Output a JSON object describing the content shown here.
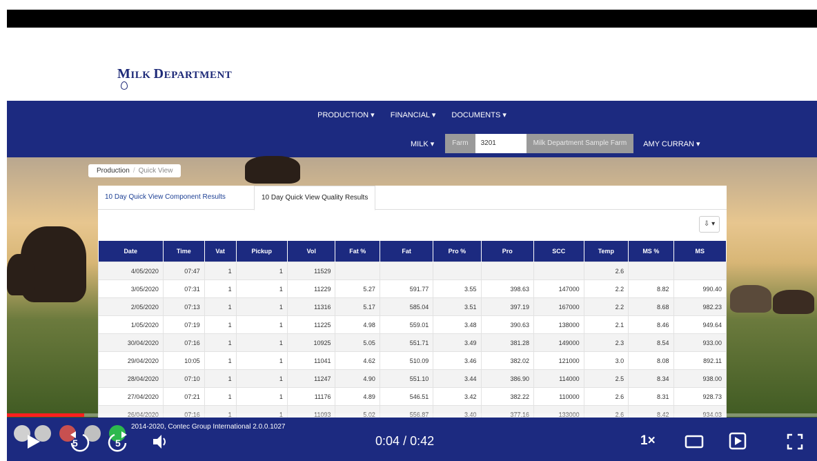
{
  "brand": {
    "title_big": "M",
    "title_rest": "ILK ",
    "title_big2": "D",
    "title_rest2": "EPARTMENT"
  },
  "nav": {
    "production": "PRODUCTION ▾",
    "financial": "FINANCIAL ▾",
    "documents": "DOCUMENTS ▾",
    "milk": "MILK ▾",
    "farm_label": "Farm",
    "farm_value": "3201",
    "farm_name": "Milk Department Sample Farm",
    "user": "AMY CURRAN ▾"
  },
  "breadcrumb": {
    "parent": "Production",
    "separator": "/",
    "current": "Quick View"
  },
  "tabs": [
    "10 Day Quick View Component Results",
    "10 Day Quick View Quality Results"
  ],
  "export_label": "⇩ ▾",
  "table": {
    "headers": [
      "Date",
      "Time",
      "Vat",
      "Pickup",
      "Vol",
      "Fat %",
      "Fat",
      "Pro %",
      "Pro",
      "SCC",
      "Temp",
      "MS %",
      "MS"
    ],
    "rows": [
      [
        "4/05/2020",
        "07:47",
        "1",
        "1",
        "11529",
        "",
        "",
        "",
        "",
        "",
        "2.6",
        "",
        ""
      ],
      [
        "3/05/2020",
        "07:31",
        "1",
        "1",
        "11229",
        "5.27",
        "591.77",
        "3.55",
        "398.63",
        "147000",
        "2.2",
        "8.82",
        "990.40"
      ],
      [
        "2/05/2020",
        "07:13",
        "1",
        "1",
        "11316",
        "5.17",
        "585.04",
        "3.51",
        "397.19",
        "167000",
        "2.2",
        "8.68",
        "982.23"
      ],
      [
        "1/05/2020",
        "07:19",
        "1",
        "1",
        "11225",
        "4.98",
        "559.01",
        "3.48",
        "390.63",
        "138000",
        "2.1",
        "8.46",
        "949.64"
      ],
      [
        "30/04/2020",
        "07:16",
        "1",
        "1",
        "10925",
        "5.05",
        "551.71",
        "3.49",
        "381.28",
        "149000",
        "2.3",
        "8.54",
        "933.00"
      ],
      [
        "29/04/2020",
        "10:05",
        "1",
        "1",
        "11041",
        "4.62",
        "510.09",
        "3.46",
        "382.02",
        "121000",
        "3.0",
        "8.08",
        "892.11"
      ],
      [
        "28/04/2020",
        "07:10",
        "1",
        "1",
        "11247",
        "4.90",
        "551.10",
        "3.44",
        "386.90",
        "114000",
        "2.5",
        "8.34",
        "938.00"
      ],
      [
        "27/04/2020",
        "07:21",
        "1",
        "1",
        "11176",
        "4.89",
        "546.51",
        "3.42",
        "382.22",
        "110000",
        "2.6",
        "8.31",
        "928.73"
      ],
      [
        "26/04/2020",
        "07:16",
        "1",
        "1",
        "11093",
        "5.02",
        "556.87",
        "3.40",
        "377.16",
        "133000",
        "2.6",
        "8.42",
        "934.03"
      ]
    ]
  },
  "footer": {
    "copyright": "2014-2020, Contec Group International 2.0.0.1027"
  },
  "player": {
    "current_time": "0:04",
    "separator": "/",
    "duration": "0:42",
    "progress_fraction": 0.095,
    "speed": "1×",
    "rewind_seconds": "5",
    "forward_seconds": "5",
    "icons": [
      "play-icon",
      "rewind-5-icon",
      "forward-5-icon",
      "volume-icon",
      "theater-icon",
      "miniplayer-icon",
      "fullscreen-icon"
    ]
  }
}
